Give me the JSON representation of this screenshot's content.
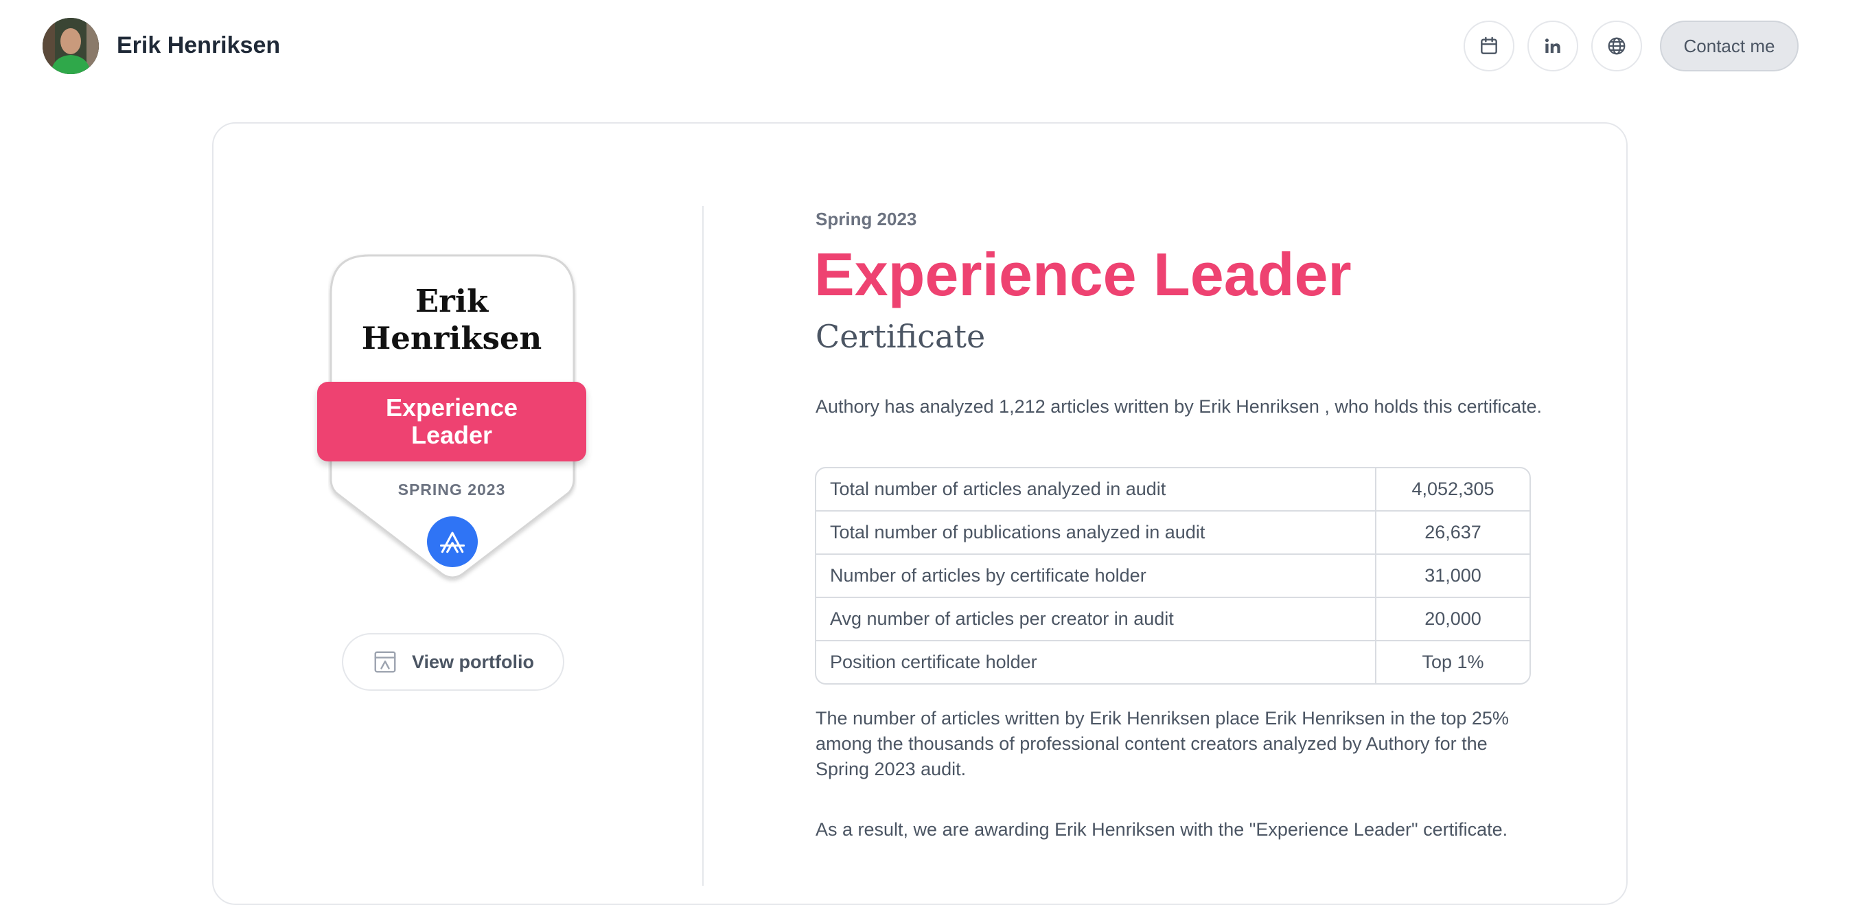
{
  "header": {
    "name": "Erik Henriksen",
    "contact_label": "Contact me",
    "icons": [
      "calendar-icon",
      "linkedin-icon",
      "globe-icon"
    ]
  },
  "badge": {
    "name": "Erik Henriksen",
    "title": "Experience Leader",
    "period": "SPRING 2023",
    "logo_icon": "authory-logo-icon"
  },
  "portfolio": {
    "label": "View portfolio",
    "icon": "portfolio-icon"
  },
  "certificate": {
    "period": "Spring 2023",
    "title": "Experience Leader",
    "subtitle": "Certificate",
    "intro": "Authory has analyzed 1,212 articles written by Erik Henriksen , who holds this certificate.",
    "stats": [
      {
        "label": "Total number of articles analyzed in audit",
        "value": "4,052,305"
      },
      {
        "label": "Total number of publications analyzed in audit",
        "value": "26,637"
      },
      {
        "label": "Number of articles by certificate holder",
        "value": "31,000"
      },
      {
        "label": "Avg number of articles per creator in audit",
        "value": "20,000"
      },
      {
        "label": "Position certificate holder",
        "value": "Top 1%"
      }
    ],
    "summary": "The number of articles written by Erik Henriksen place Erik Henriksen in the top 25% among the thousands of professional content creators analyzed by Authory for the Spring 2023 audit.",
    "result": "As a result, we are awarding Erik Henriksen with the \"Experience Leader\" certificate."
  },
  "colors": {
    "accent": "#ee4271",
    "logo_blue": "#2f74f5",
    "text": "#4b5563",
    "border": "#e5e7eb"
  }
}
